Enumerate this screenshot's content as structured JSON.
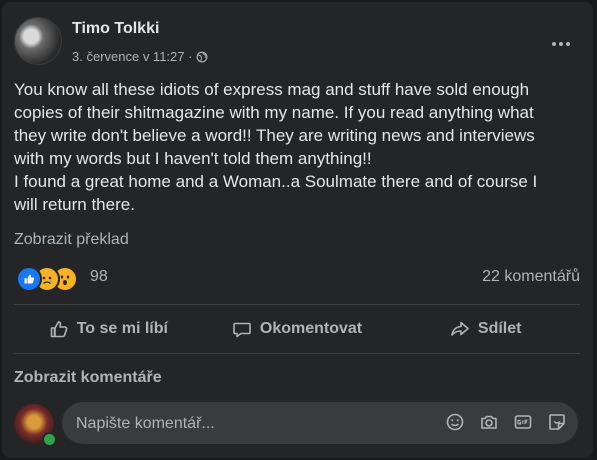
{
  "post": {
    "author": "Timo Tolkki",
    "date": "3. července v 11:27 ·",
    "text": "You know all these idiots of express mag and stuff have sold enough\ncopies of their shitmagazine with my name. If you read anything what\nthey write don't believe a word!! They are writing news and interviews\nwith my words but I haven't told them anything!!\nI found a great home and a Woman..a Soulmate there and of course I\nwill return there.",
    "translate_label": "Zobrazit překlad"
  },
  "reactions": {
    "icons": [
      "like-reaction-icon",
      "sad-reaction-icon",
      "wow-reaction-icon"
    ],
    "count": "98",
    "comments_count": "22 komentářů"
  },
  "actions": {
    "like": "To se mi líbí",
    "comment": "Okomentovat",
    "share": "Sdílet"
  },
  "comments": {
    "view_label": "Zobrazit komentáře",
    "input_placeholder": "Napište komentář..."
  },
  "colors": {
    "background": "#18191a",
    "card": "#242526",
    "text": "#e4e6eb",
    "secondary_text": "#b0b3b8",
    "like_blue": "#1877f2",
    "online_green": "#31a24c"
  }
}
